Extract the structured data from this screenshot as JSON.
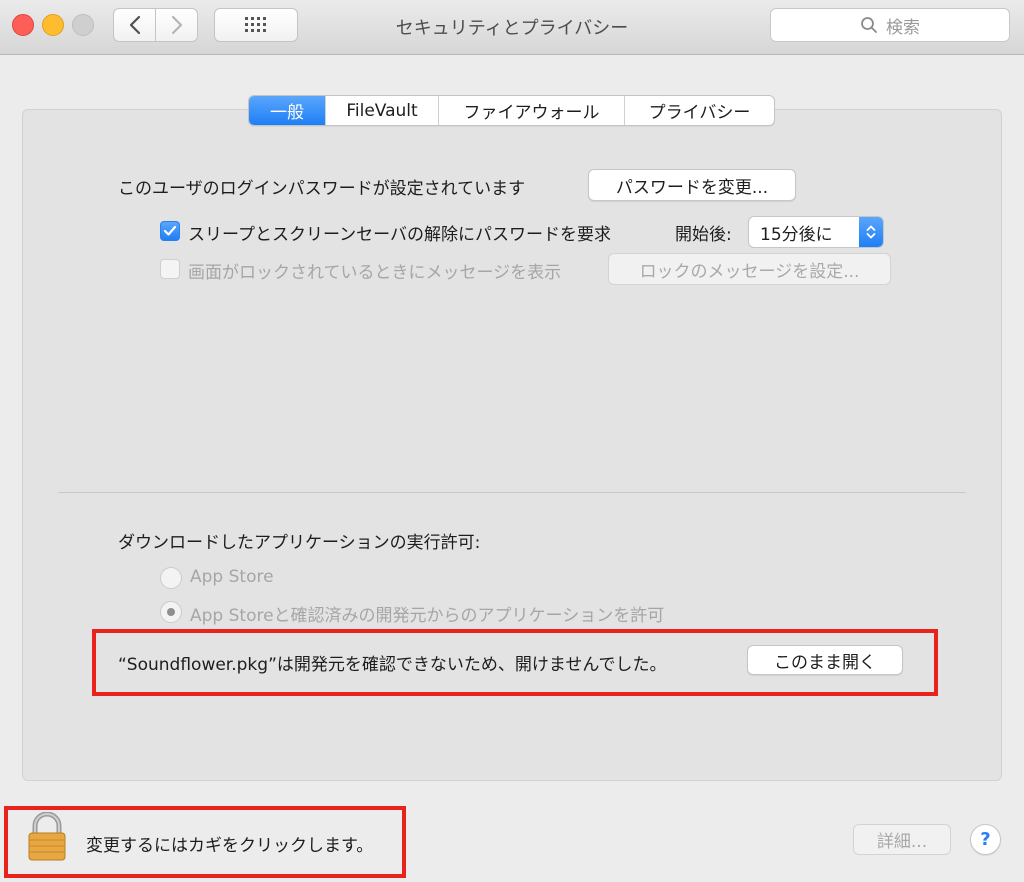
{
  "window": {
    "title": "セキュリティとプライバシー",
    "search_placeholder": "検索"
  },
  "tabs": [
    {
      "label": "一般",
      "active": true
    },
    {
      "label": "FileVault",
      "active": false
    },
    {
      "label": "ファイアウォール",
      "active": false
    },
    {
      "label": "プライバシー",
      "active": false
    }
  ],
  "general": {
    "login_password_text": "このユーザのログインパスワードが設定されています",
    "change_password_button": "パスワードを変更...",
    "require_password": {
      "label": "スリープとスクリーンセーバの解除にパスワードを要求",
      "checked": true,
      "delay_label": "開始後:",
      "delay_value": "15分後に"
    },
    "lock_message": {
      "label": "画面がロックされているときにメッセージを表示",
      "checked": false,
      "button": "ロックのメッセージを設定..."
    }
  },
  "downloads": {
    "heading": "ダウンロードしたアプリケーションの実行許可:",
    "options": [
      {
        "label": "App Store",
        "selected": false
      },
      {
        "label": "App Storeと確認済みの開発元からのアプリケーションを許可",
        "selected": true
      }
    ],
    "blocked_message": "“Soundflower.pkg”は開発元を確認できないため、開けませんでした。",
    "open_anyway_button": "このまま開く"
  },
  "footer": {
    "lock_text": "変更するにはカギをクリックします。",
    "advanced_button": "詳細...",
    "help_label": "?"
  },
  "colors": {
    "accent": "#1e7ff6",
    "highlight": "#e8231c"
  }
}
